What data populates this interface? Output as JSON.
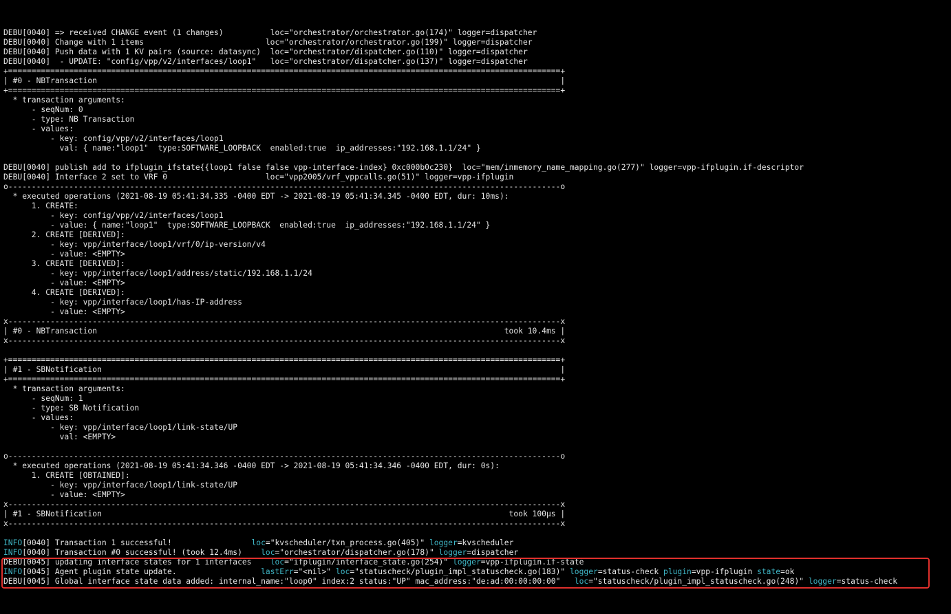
{
  "colors": {
    "background": "#000000",
    "text": "#e6e6e6",
    "cyan": "#3fb6c6",
    "highlight_border": "#e0302c"
  },
  "lines": [
    "DEBU[0040] => received CHANGE event (1 changes)          loc=\"orchestrator/orchestrator.go(174)\" logger=dispatcher",
    "DEBU[0040] Change with 1 items                          loc=\"orchestrator/orchestrator.go(199)\" logger=dispatcher",
    "DEBU[0040] Push data with 1 KV pairs (source: datasync)  loc=\"orchestrator/dispatcher.go(110)\" logger=dispatcher",
    "DEBU[0040]  - UPDATE: \"config/vpp/v2/interfaces/loop1\"   loc=\"orchestrator/dispatcher.go(137)\" logger=dispatcher",
    "+======================================================================================================================+",
    "| #0 - NBTransaction                                                                                                   |",
    "+======================================================================================================================+",
    "  * transaction arguments:",
    "      - seqNum: 0",
    "      - type: NB Transaction",
    "      - values:",
    "          - key: config/vpp/v2/interfaces/loop1",
    "            val: { name:\"loop1\"  type:SOFTWARE_LOOPBACK  enabled:true  ip_addresses:\"192.168.1.1/24\" }",
    "",
    "DEBU[0040] publish add to ifplugin_ifstate{{loop1 false false vpp-interface-index} 0xc000b0c230}  loc=\"mem/inmemory_name_mapping.go(277)\" logger=vpp-ifplugin.if-descriptor",
    "DEBU[0040] Interface 2 set to VRF 0                     loc=\"vpp2005/vrf_vppcalls.go(51)\" logger=vpp-ifplugin",
    "o----------------------------------------------------------------------------------------------------------------------o",
    "  * executed operations (2021-08-19 05:41:34.335 -0400 EDT -> 2021-08-19 05:41:34.345 -0400 EDT, dur: 10ms):",
    "      1. CREATE:",
    "          - key: config/vpp/v2/interfaces/loop1",
    "          - value: { name:\"loop1\"  type:SOFTWARE_LOOPBACK  enabled:true  ip_addresses:\"192.168.1.1/24\" }",
    "      2. CREATE [DERIVED]:",
    "          - key: vpp/interface/loop1/vrf/0/ip-version/v4",
    "          - value: <EMPTY>",
    "      3. CREATE [DERIVED]:",
    "          - key: vpp/interface/loop1/address/static/192.168.1.1/24",
    "          - value: <EMPTY>",
    "      4. CREATE [DERIVED]:",
    "          - key: vpp/interface/loop1/has-IP-address",
    "          - value: <EMPTY>",
    "x----------------------------------------------------------------------------------------------------------------------x",
    "| #0 - NBTransaction                                                                                       took 10.4ms |",
    "x----------------------------------------------------------------------------------------------------------------------x",
    "",
    "+======================================================================================================================+",
    "| #1 - SBNotification                                                                                                  |",
    "+======================================================================================================================+",
    "  * transaction arguments:",
    "      - seqNum: 1",
    "      - type: SB Notification",
    "      - values:",
    "          - key: vpp/interface/loop1/link-state/UP",
    "            val: <EMPTY>",
    "",
    "o----------------------------------------------------------------------------------------------------------------------o",
    "  * executed operations (2021-08-19 05:41:34.346 -0400 EDT -> 2021-08-19 05:41:34.346 -0400 EDT, dur: 0s):",
    "      1. CREATE [OBTAINED]:",
    "          - key: vpp/interface/loop1/link-state/UP",
    "          - value: <EMPTY>",
    "x----------------------------------------------------------------------------------------------------------------------x",
    "| #1 - SBNotification                                                                                       took 100µs |",
    "x----------------------------------------------------------------------------------------------------------------------x",
    ""
  ],
  "info1": {
    "level": "INFO",
    "msg": "[0040] Transaction 1 successful!                 ",
    "loc_k": "loc",
    "loc_v": "=\"kvscheduler/txn_process.go(405)\" ",
    "logger_k": "logger",
    "logger_v": "=kvscheduler"
  },
  "info2": {
    "level": "INFO",
    "msg": "[0040] Transaction #0 successful! (took 12.4ms)    ",
    "loc_k": "loc",
    "loc_v": "=\"orchestrator/dispatcher.go(178)\" ",
    "logger_k": "logger",
    "logger_v": "=dispatcher"
  },
  "debu1": {
    "level": "DEBU",
    "msg": "[0045] updating interface states for 1 interfaces    ",
    "loc_k": "loc",
    "loc_v": "=\"ifplugin/interface_state.go(254)\" ",
    "logger_k": "logger",
    "logger_v": "=vpp-ifplugin.if-state"
  },
  "info3": {
    "level": "INFO",
    "msg": "[0045] Agent plugin state update.                  ",
    "lasterr_k": "lastErr",
    "lasterr_v": "=\"<nil>\" ",
    "loc_k": "loc",
    "loc_v": "=\"statuscheck/plugin_impl_statuscheck.go(183)\" ",
    "logger_k": "logger",
    "logger_v": "=status-check ",
    "plugin_k": "plugin",
    "plugin_v": "=vpp-ifplugin ",
    "state_k": "state",
    "state_v": "=ok"
  },
  "debu2": {
    "level": "DEBU",
    "msg": "[0045] Global interface state data added: internal_name:\"loop0\" index:2 status:\"UP\" mac_address:\"de:ad:00:00:00:00\"   ",
    "loc_k": "loc",
    "loc_v": "=\"statuscheck/plugin_impl_statuscheck.go(248)\" ",
    "logger_k": "logger",
    "logger_v": "=status-check"
  }
}
